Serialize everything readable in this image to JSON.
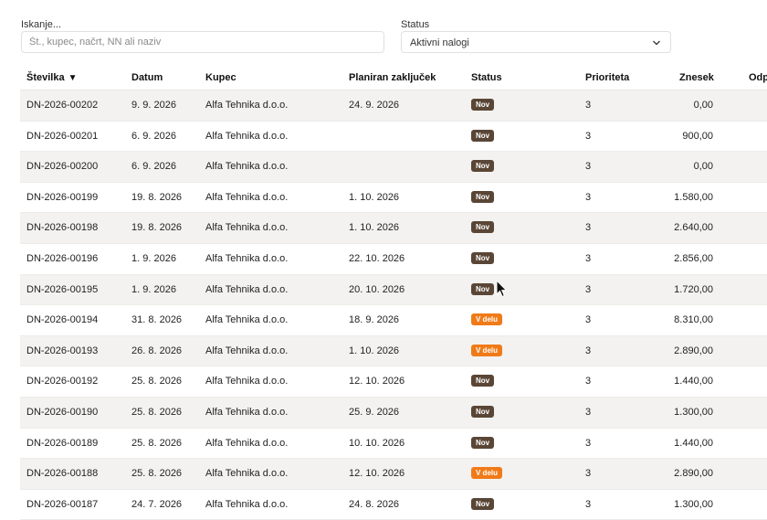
{
  "filters": {
    "search_label": "Iskanje...",
    "search_placeholder": "Št., kupec, načrt, NN ali naziv",
    "search_value": "",
    "status_label": "Status",
    "status_value": "Aktivni nalogi",
    "status_icon": "chevron-down-icon"
  },
  "table": {
    "columns": [
      "Številka",
      "Datum",
      "Kupec",
      "Planiran zaključek",
      "Status",
      "Prioriteta",
      "Znesek",
      "Odp"
    ],
    "sort_indicator": "▼",
    "status_colors": {
      "Nov": "#5a4636",
      "V delu": "#f07a18"
    },
    "rows": [
      {
        "stevilka": "DN-2026-00202",
        "datum": "9. 9. 2026",
        "kupec": "Alfa Tehnika d.o.o.",
        "planiran": "24. 9. 2026",
        "status": "Nov",
        "prioriteta": "3",
        "znesek": "0,00"
      },
      {
        "stevilka": "DN-2026-00201",
        "datum": "6. 9. 2026",
        "kupec": "Alfa Tehnika d.o.o.",
        "planiran": "",
        "status": "Nov",
        "prioriteta": "3",
        "znesek": "900,00"
      },
      {
        "stevilka": "DN-2026-00200",
        "datum": "6. 9. 2026",
        "kupec": "Alfa Tehnika d.o.o.",
        "planiran": "",
        "status": "Nov",
        "prioriteta": "3",
        "znesek": "0,00"
      },
      {
        "stevilka": "DN-2026-00199",
        "datum": "19. 8. 2026",
        "kupec": "Alfa Tehnika d.o.o.",
        "planiran": "1. 10. 2026",
        "status": "Nov",
        "prioriteta": "3",
        "znesek": "1.580,00"
      },
      {
        "stevilka": "DN-2026-00198",
        "datum": "19. 8. 2026",
        "kupec": "Alfa Tehnika d.o.o.",
        "planiran": "1. 10. 2026",
        "status": "Nov",
        "prioriteta": "3",
        "znesek": "2.640,00"
      },
      {
        "stevilka": "DN-2026-00196",
        "datum": "1. 9. 2026",
        "kupec": "Alfa Tehnika d.o.o.",
        "planiran": "22. 10. 2026",
        "status": "Nov",
        "prioriteta": "3",
        "znesek": "2.856,00"
      },
      {
        "stevilka": "DN-2026-00195",
        "datum": "1. 9. 2026",
        "kupec": "Alfa Tehnika d.o.o.",
        "planiran": "20. 10. 2026",
        "status": "Nov",
        "prioriteta": "3",
        "znesek": "1.720,00"
      },
      {
        "stevilka": "DN-2026-00194",
        "datum": "31. 8. 2026",
        "kupec": "Alfa Tehnika d.o.o.",
        "planiran": "18. 9. 2026",
        "status": "V delu",
        "prioriteta": "3",
        "znesek": "8.310,00"
      },
      {
        "stevilka": "DN-2026-00193",
        "datum": "26. 8. 2026",
        "kupec": "Alfa Tehnika d.o.o.",
        "planiran": "1. 10. 2026",
        "status": "V delu",
        "prioriteta": "3",
        "znesek": "2.890,00"
      },
      {
        "stevilka": "DN-2026-00192",
        "datum": "25. 8. 2026",
        "kupec": "Alfa Tehnika d.o.o.",
        "planiran": "12. 10. 2026",
        "status": "Nov",
        "prioriteta": "3",
        "znesek": "1.440,00"
      },
      {
        "stevilka": "DN-2026-00190",
        "datum": "25. 8. 2026",
        "kupec": "Alfa Tehnika d.o.o.",
        "planiran": "25. 9. 2026",
        "status": "Nov",
        "prioriteta": "3",
        "znesek": "1.300,00"
      },
      {
        "stevilka": "DN-2026-00189",
        "datum": "25. 8. 2026",
        "kupec": "Alfa Tehnika d.o.o.",
        "planiran": "10. 10. 2026",
        "status": "Nov",
        "prioriteta": "3",
        "znesek": "1.440,00"
      },
      {
        "stevilka": "DN-2026-00188",
        "datum": "25. 8. 2026",
        "kupec": "Alfa Tehnika d.o.o.",
        "planiran": "12. 10. 2026",
        "status": "V delu",
        "prioriteta": "3",
        "znesek": "2.890,00"
      },
      {
        "stevilka": "DN-2026-00187",
        "datum": "24. 7. 2026",
        "kupec": "Alfa Tehnika d.o.o.",
        "planiran": "24. 8. 2026",
        "status": "Nov",
        "prioriteta": "3",
        "znesek": "1.300,00"
      }
    ]
  }
}
